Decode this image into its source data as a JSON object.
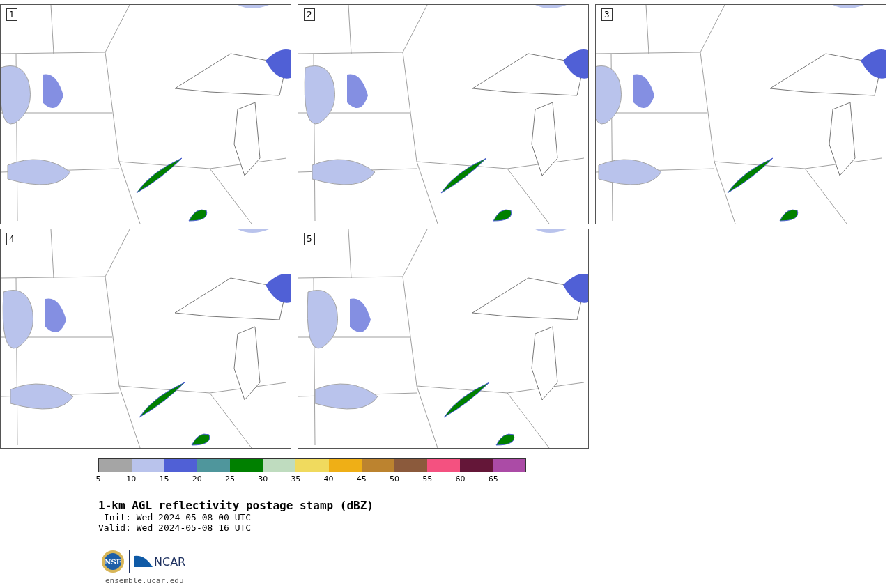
{
  "panels": [
    {
      "label": "1"
    },
    {
      "label": "2"
    },
    {
      "label": "3"
    },
    {
      "label": "4"
    },
    {
      "label": "5"
    }
  ],
  "colorbar": {
    "segments": [
      {
        "color": "#a5a5a5"
      },
      {
        "color": "#b9c3ec"
      },
      {
        "color": "#5060d6"
      },
      {
        "color": "#4f969c"
      },
      {
        "color": "#008000"
      },
      {
        "color": "#bfdcbf"
      },
      {
        "color": "#f0da5e"
      },
      {
        "color": "#efaf16"
      },
      {
        "color": "#bc832f"
      },
      {
        "color": "#8b5a3c"
      },
      {
        "color": "#f45180"
      },
      {
        "color": "#641638"
      },
      {
        "color": "#ab4ba6"
      }
    ],
    "ticks": [
      "5",
      "10",
      "15",
      "20",
      "25",
      "30",
      "35",
      "40",
      "45",
      "50",
      "55",
      "60",
      "65"
    ]
  },
  "title": "1-km AGL reflectivity postage stamp (dBZ)",
  "init": " Init: Wed 2024-05-08 00 UTC",
  "valid": "Valid: Wed 2024-05-08 16 UTC",
  "logo": {
    "wordmark": "NCAR",
    "seal": "NSF"
  },
  "url": "ensemble.ucar.edu"
}
